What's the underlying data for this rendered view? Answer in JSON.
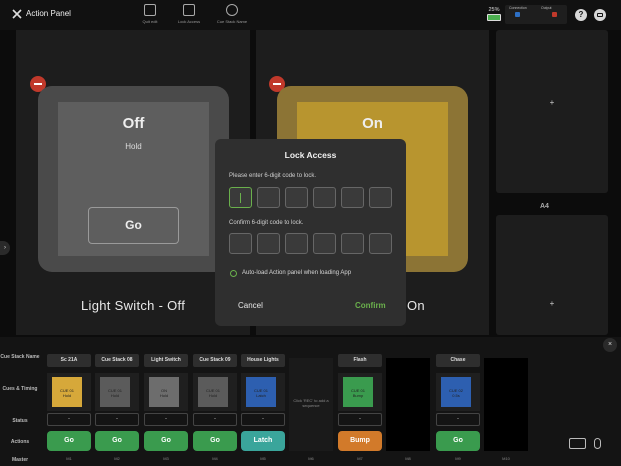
{
  "app": {
    "title": "Action Panel"
  },
  "toolbar": [
    {
      "label": "Quit edit",
      "icon": "edit-icon"
    },
    {
      "label": "Lock Access",
      "icon": "lock-icon"
    },
    {
      "label": "Cue Stack Name",
      "icon": "eye-icon"
    }
  ],
  "status": {
    "battery": "25%",
    "battery_level": 0.25,
    "connection_label": "Connection",
    "output_label": "Output",
    "help": "?"
  },
  "panels": {
    "left": {
      "state": "Off",
      "mode": "Hold",
      "button": "Go",
      "name": "Light Switch - Off",
      "color": "#5e5e5e"
    },
    "mid": {
      "state": "On",
      "name_visible": "On",
      "color": "#b8952f"
    },
    "right_label": "A4",
    "add": "+"
  },
  "modal": {
    "title": "Lock Access",
    "enter_prompt": "Please enter 6-digit code to lock.",
    "confirm_prompt": "Confirm 6-digit code to lock.",
    "auto_load": "Auto-load Action panel when loading App",
    "cancel": "Cancel",
    "confirm": "Confirm"
  },
  "cue_bar": {
    "row_labels": [
      "Cue Stack Name",
      "Cues & Timing",
      "Status",
      "Actions",
      "Master"
    ],
    "slots": [
      {
        "name": "Sc 21A",
        "cue": "CUE 01",
        "cue_mode": "Hold",
        "status": "-",
        "action": "Go",
        "master": "M1",
        "cue_color": "#d6a83a",
        "action_color": "#3a9b4e"
      },
      {
        "name": "Cue Stack 08",
        "cue": "CUE 01",
        "cue_mode": "Hold",
        "status": "-",
        "action": "Go",
        "master": "M2",
        "cue_color": "#5b5b5b",
        "action_color": "#3a9b4e"
      },
      {
        "name": "Light Switch",
        "cue": "ON",
        "cue_mode": "Hold",
        "status": "-",
        "action": "Go",
        "master": "M3",
        "cue_color": "#6d6d6d",
        "action_color": "#3a9b4e"
      },
      {
        "name": "Cue Stack 09",
        "cue": "CUE 01",
        "cue_mode": "Hold",
        "status": "-",
        "action": "Go",
        "master": "M4",
        "cue_color": "#5b5b5b",
        "action_color": "#3a9b4e"
      },
      {
        "name": "House Lights",
        "cue": "CUE 01",
        "cue_mode": "Latch",
        "status": "-",
        "action": "Latch",
        "master": "M5",
        "cue_color": "#2d5fb0",
        "action_color": "#3aa59b"
      },
      {
        "name": "Flash",
        "cue": "CUE 01",
        "cue_mode": "Bump",
        "status": "-",
        "action": "Bump",
        "master": "M7",
        "cue_color": "#3a9b4e",
        "action_color": "#d27a2a"
      },
      {
        "name": "Chase",
        "cue": "CUE 02",
        "cue_mode": "0.5s",
        "status": "-",
        "action": "Go",
        "master": "M9",
        "cue_color": "#2d5fb0",
        "action_color": "#3a9b4e"
      }
    ],
    "empty_slots": [
      {
        "master": "M6",
        "hint": "Click 'REC' to add a sequence"
      },
      {
        "master": "M8"
      },
      {
        "master": "M10"
      }
    ]
  }
}
